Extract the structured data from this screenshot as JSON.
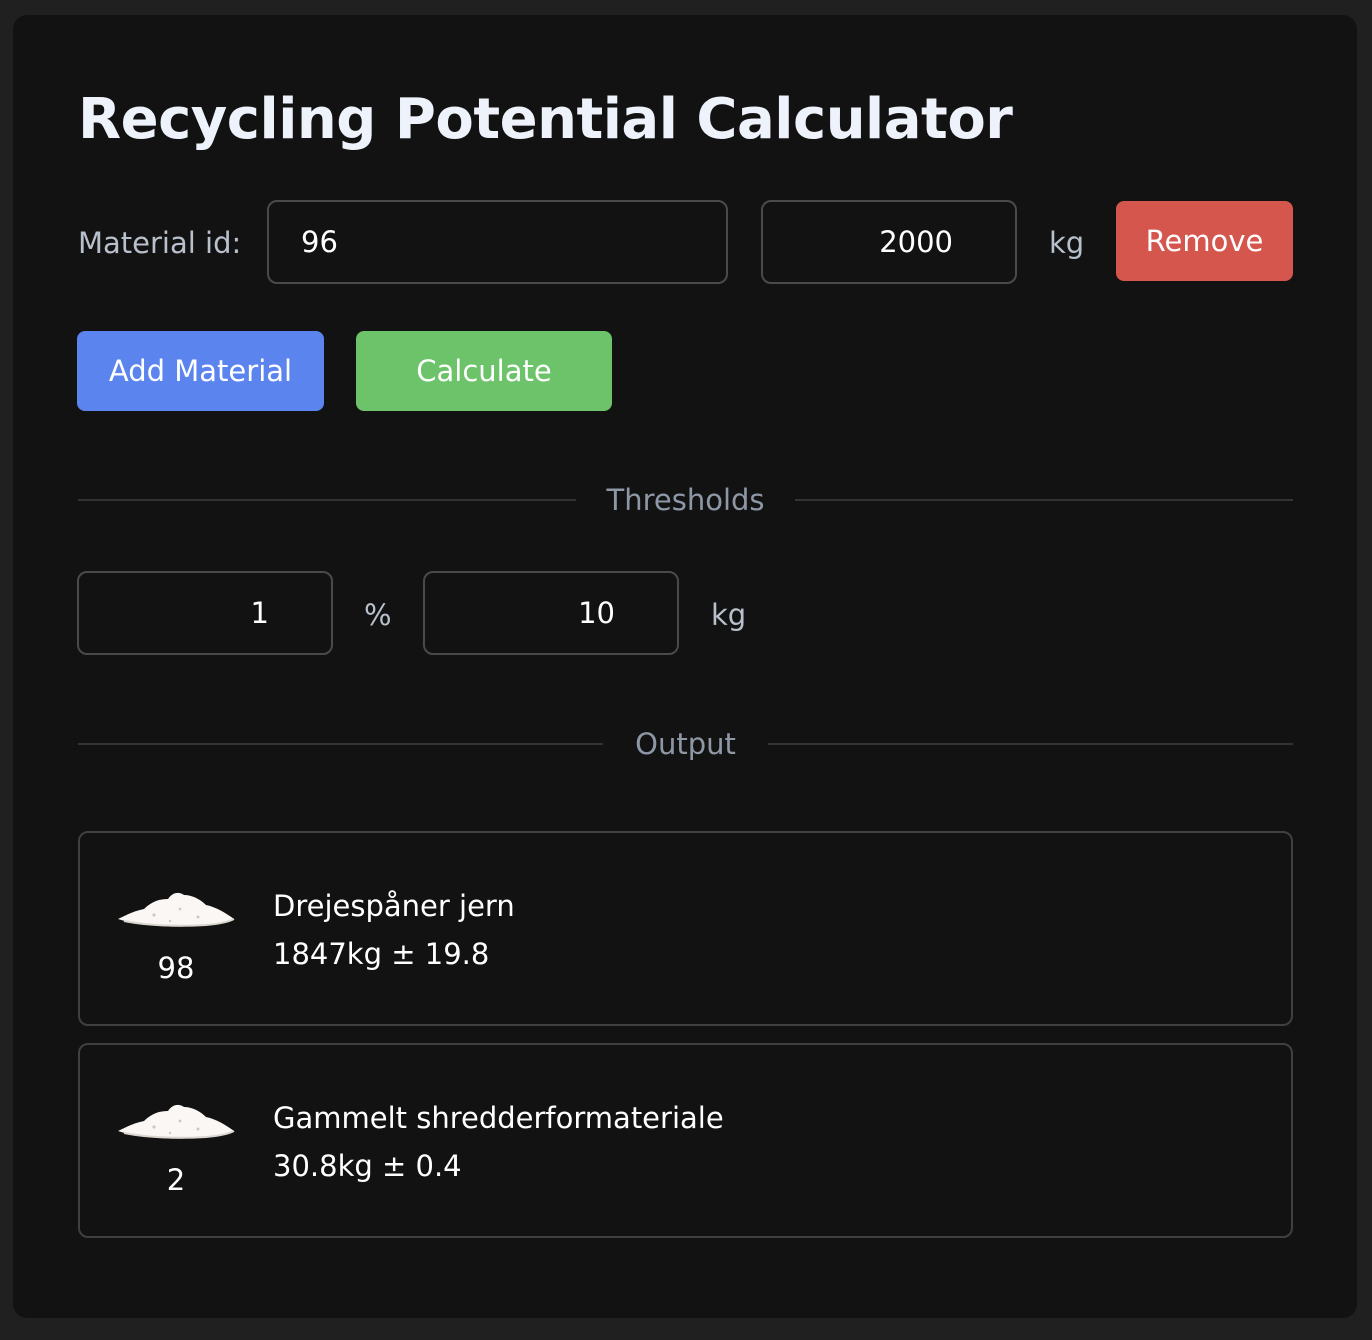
{
  "title": "Recycling Potential Calculator",
  "material_row": {
    "label": "Material id:",
    "id_value": "96",
    "weight_value": "2000",
    "unit": "kg",
    "remove_label": "Remove"
  },
  "actions": {
    "add_label": "Add Material",
    "calculate_label": "Calculate"
  },
  "thresholds": {
    "heading": "Thresholds",
    "percent_value": "1",
    "percent_unit": "%",
    "weight_value": "10",
    "weight_unit": "kg"
  },
  "output": {
    "heading": "Output",
    "results": [
      {
        "icon": "material-pile-icon",
        "id": "98",
        "name": "Drejespåner jern",
        "amount": "1847kg ± 19.8"
      },
      {
        "icon": "material-pile-icon",
        "id": "2",
        "name": "Gammelt shredderformateriale",
        "amount": "30.8kg ± 0.4"
      }
    ]
  },
  "colors": {
    "remove": "#d4564d",
    "add": "#5b84ee",
    "calculate": "#6cc36a",
    "background": "#121212"
  }
}
